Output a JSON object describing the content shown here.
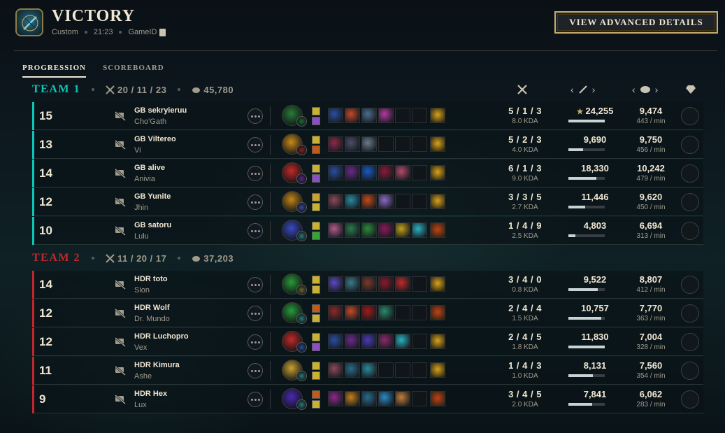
{
  "header": {
    "title": "VICTORY",
    "mode": "Custom",
    "duration": "21:23",
    "game_id_label": "GameID",
    "advanced_button": "VIEW ADVANCED DETAILS"
  },
  "tabs": [
    {
      "label": "PROGRESSION",
      "active": true
    },
    {
      "label": "SCOREBOARD",
      "active": false
    }
  ],
  "colors": {
    "team1": "#0ac8b9",
    "team2": "#c1272d",
    "accent_gold": "#c8aa6e"
  },
  "teams": [
    {
      "name": "TEAM 1",
      "kda": "20 / 11 / 23",
      "gold": "45,780",
      "players": [
        {
          "level": "15",
          "name": "GB sekryieruu",
          "champion": "Cho'Gath",
          "kda": "5 / 1 / 3",
          "kda_ratio": "8.0 KDA",
          "damage": "24,255",
          "damage_top": true,
          "damage_fraction": 1.0,
          "gold": "9,474",
          "gpm": "443 / min",
          "champ_color": "#2a7a3a",
          "keystone": "#1f6d2e",
          "spells": [
            "#c9b233",
            "#8a4fc4"
          ],
          "items": [
            "#2a4ea0",
            "#c2492a",
            "#4b6d8e",
            "#b23aa0",
            "",
            ""
          ],
          "trinket": "#d7a320"
        },
        {
          "level": "13",
          "name": "GB Viltereo",
          "champion": "Vi",
          "kda": "5 / 2 / 3",
          "kda_ratio": "4.0 KDA",
          "damage": "9,690",
          "damage_top": false,
          "damage_fraction": 0.4,
          "gold": "9,750",
          "gpm": "456 / min",
          "champ_color": "#c98a1a",
          "keystone": "#8a2020",
          "spells": [
            "#c9b233",
            "#c25a1a"
          ],
          "items": [
            "#8a2a4a",
            "#4a4e6a",
            "#6a7a8a",
            "",
            "",
            ""
          ],
          "trinket": "#d7a320"
        },
        {
          "level": "14",
          "name": "GB alive",
          "champion": "Anivia",
          "kda": "6 / 1 / 3",
          "kda_ratio": "9.0 KDA",
          "damage": "18,330",
          "damage_top": false,
          "damage_fraction": 0.76,
          "gold": "10,242",
          "gpm": "479 / min",
          "champ_color": "#c22a2a",
          "keystone": "#5a2a8a",
          "spells": [
            "#c9b233",
            "#8a4fc4"
          ],
          "items": [
            "#2a4ea0",
            "#6a2a8a",
            "#1a5ac2",
            "#8a1a3a",
            "#b24a6a",
            ""
          ],
          "trinket": "#d7a320"
        },
        {
          "level": "12",
          "name": "GB Yunite",
          "champion": "Jhin",
          "kda": "3 / 3 / 5",
          "kda_ratio": "2.7 KDA",
          "damage": "11,446",
          "damage_top": false,
          "damage_fraction": 0.47,
          "gold": "9,620",
          "gpm": "450 / min",
          "champ_color": "#c2861a",
          "keystone": "#3a4a9a",
          "spells": [
            "#c9a233",
            "#c9b233"
          ],
          "items": [
            "#8a4a5a",
            "#2a8aa0",
            "#c24a1a",
            "#8a6ac2",
            "",
            ""
          ],
          "trinket": "#d7a320"
        },
        {
          "level": "10",
          "name": "GB satoru",
          "champion": "Lulu",
          "kda": "1 / 4 / 9",
          "kda_ratio": "2.5 KDA",
          "damage": "4,803",
          "damage_top": false,
          "damage_fraction": 0.2,
          "gold": "6,694",
          "gpm": "313 / min",
          "champ_color": "#3a4ac2",
          "keystone": "#2a7a7a",
          "spells": [
            "#c9b233",
            "#3aa03a"
          ],
          "items": [
            "#b25a8a",
            "#2a7a4a",
            "#2a8a3a",
            "#8a1a5a",
            "#c2a01a",
            "#2ab2c2"
          ],
          "trinket": "#c2401a"
        }
      ]
    },
    {
      "name": "TEAM 2",
      "kda": "11 / 20 / 17",
      "gold": "37,203",
      "players": [
        {
          "level": "14",
          "name": "HDR toto",
          "champion": "Sion",
          "kda": "3 / 4 / 0",
          "kda_ratio": "0.8 KDA",
          "damage": "9,522",
          "damage_top": false,
          "damage_fraction": 0.8,
          "gold": "8,807",
          "gpm": "412 / min",
          "champ_color": "#2a9a3a",
          "keystone": "#6a6a2a",
          "spells": [
            "#c9b233",
            "#c9b233"
          ],
          "items": [
            "#5a4ac2",
            "#3a7a8a",
            "#7a3a2a",
            "#8a1a2a",
            "#c22a2a",
            ""
          ],
          "trinket": "#d7a320",
          "item_extra": "#4a5a8a"
        },
        {
          "level": "12",
          "name": "HDR Wolf",
          "champion": "Dr. Mundo",
          "kda": "2 / 4 / 4",
          "kda_ratio": "1.5 KDA",
          "damage": "10,757",
          "damage_top": false,
          "damage_fraction": 0.9,
          "gold": "7,770",
          "gpm": "363 / min",
          "champ_color": "#2a9a3a",
          "keystone": "#2a7a7a",
          "spells": [
            "#c25a1a",
            "#c9b233"
          ],
          "items": [
            "#8a2a2a",
            "#c24a2a",
            "#a01a1a",
            "#2a8a6a",
            "",
            ""
          ],
          "trinket": "#c2401a"
        },
        {
          "level": "12",
          "name": "HDR Luchopro",
          "champion": "Vex",
          "kda": "2 / 4 / 5",
          "kda_ratio": "1.8 KDA",
          "damage": "11,830",
          "damage_top": false,
          "damage_fraction": 1.0,
          "gold": "7,004",
          "gpm": "328 / min",
          "champ_color": "#c22a2a",
          "keystone": "#2a4a9a",
          "spells": [
            "#c9b233",
            "#8a4fc4"
          ],
          "items": [
            "#2a4ea0",
            "#6a2a8a",
            "#4a3ab2",
            "#8a2a6a",
            "#2ab2c2",
            ""
          ],
          "trinket": "#d7a320"
        },
        {
          "level": "11",
          "name": "HDR Kimura",
          "champion": "Ashe",
          "kda": "1 / 4 / 3",
          "kda_ratio": "1.0 KDA",
          "damage": "8,131",
          "damage_top": false,
          "damage_fraction": 0.68,
          "gold": "7,560",
          "gpm": "354 / min",
          "champ_color": "#c9a233",
          "keystone": "#2a7a7a",
          "spells": [
            "#c9b233",
            "#c9b233"
          ],
          "items": [
            "#8a4a5a",
            "#2a6a8a",
            "#2a8a9a",
            "",
            "",
            ""
          ],
          "trinket": "#d7a320"
        },
        {
          "level": "9",
          "name": "HDR Hex",
          "champion": "Lux",
          "kda": "3 / 4 / 5",
          "kda_ratio": "2.0 KDA",
          "damage": "7,841",
          "damage_top": false,
          "damage_fraction": 0.66,
          "gold": "6,062",
          "gpm": "283 / min",
          "champ_color": "#4a2ab2",
          "keystone": "#2a7a7a",
          "spells": [
            "#c25a1a",
            "#c9b233"
          ],
          "items": [
            "#8a2a8a",
            "#c2801a",
            "#2a6a8a",
            "#2a8ac2",
            "#c2803a",
            ""
          ],
          "trinket": "#c2401a"
        }
      ]
    }
  ]
}
